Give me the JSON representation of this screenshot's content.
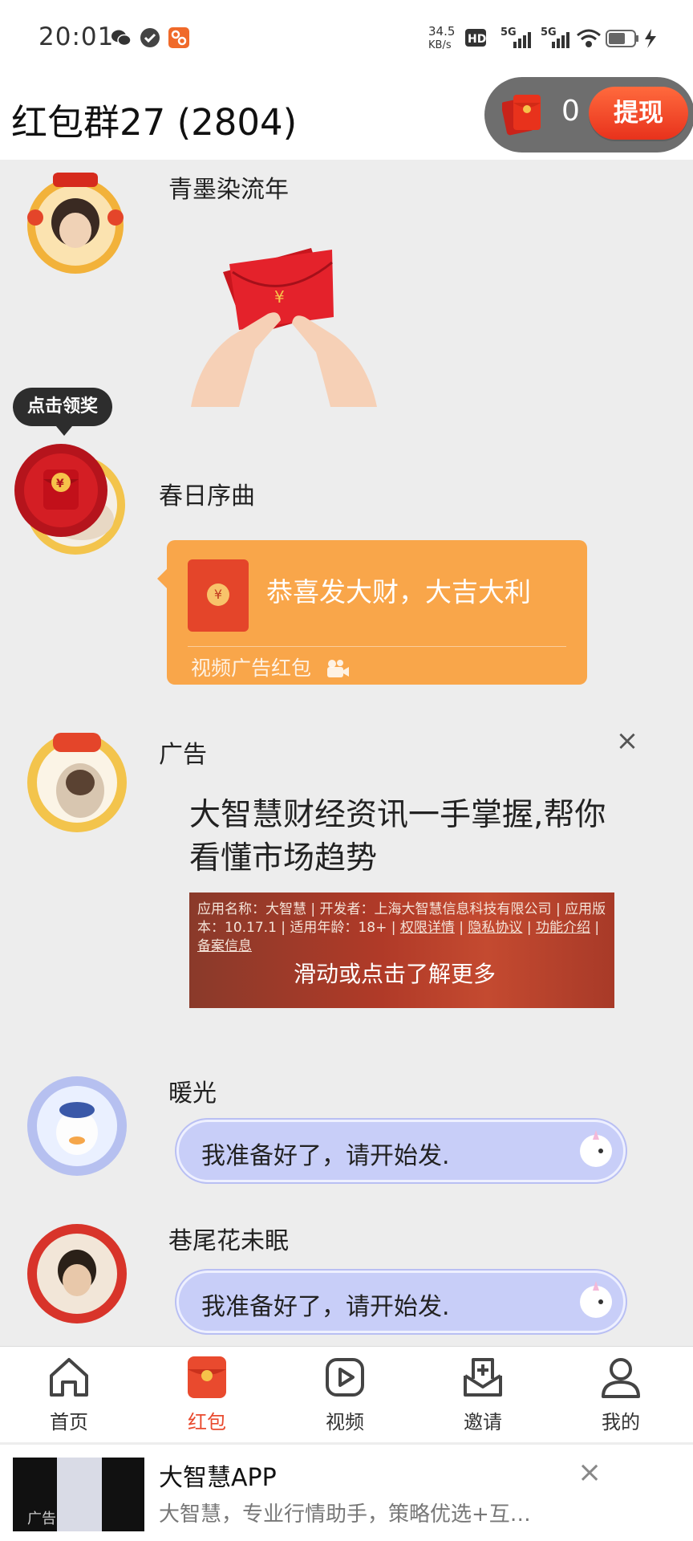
{
  "status_bar": {
    "time": "20:01",
    "net_speed_value": "34.5",
    "net_speed_unit": "KB/s",
    "hd_label": "HD",
    "signal_label_1": "5G",
    "signal_label_2": "5G",
    "icons": [
      "wechat-icon",
      "check-badge-icon",
      "app-notification-icon",
      "hd-icon",
      "signal-5g-icon",
      "signal-5g-icon",
      "wifi-icon",
      "battery-icon",
      "charging-icon"
    ]
  },
  "header": {
    "title": "红包群27 (2804)",
    "balance": "0",
    "withdraw_label": "提现"
  },
  "chat": {
    "tooltip": "点击领奖",
    "messages": [
      {
        "sender": "青墨染流年",
        "type": "red-packet-sticker"
      },
      {
        "sender": "春日序曲",
        "type": "red-packet",
        "coin_symbol": "¥",
        "wish": "恭喜发大财，大吉大利",
        "sub_label": "视频广告红包"
      },
      {
        "sender": "广告",
        "type": "ad",
        "close": "×",
        "text": "大智慧财经资讯一手掌握,帮你看懂市场趋势",
        "app_info": {
          "name_label": "应用名称：",
          "name": "大智慧",
          "developer_label": "开发者：",
          "developer": "上海大智慧信息科技有限公司",
          "version_label": "应用版本：",
          "version": "10.17.1",
          "age_label": "适用年龄：",
          "age": "18+",
          "permissions": "权限详情",
          "privacy": "隐私协议",
          "features": "功能介绍",
          "filing": "备案信息"
        },
        "cta": "滑动或点击了解更多"
      },
      {
        "sender": "暖光",
        "type": "text",
        "text": "我准备好了，请开始发."
      },
      {
        "sender": "巷尾花未眠",
        "type": "text",
        "text": "我准备好了，请开始发."
      }
    ]
  },
  "bottom_nav": {
    "items": [
      {
        "label": "首页",
        "icon": "home-icon"
      },
      {
        "label": "红包",
        "icon": "red-packet-icon",
        "active": true
      },
      {
        "label": "视频",
        "icon": "video-play-icon"
      },
      {
        "label": "邀请",
        "icon": "invite-icon"
      },
      {
        "label": "我的",
        "icon": "profile-icon"
      }
    ]
  },
  "ad_banner": {
    "name": "大智慧APP",
    "desc": "大智慧，专业行情助手，策略优选+互…",
    "tag": "广告",
    "close": "×"
  },
  "colors": {
    "accent": "#e94a2e",
    "red_packet_card": "#f9a64a",
    "bubble": "#c8cef8",
    "background": "#ededed"
  }
}
